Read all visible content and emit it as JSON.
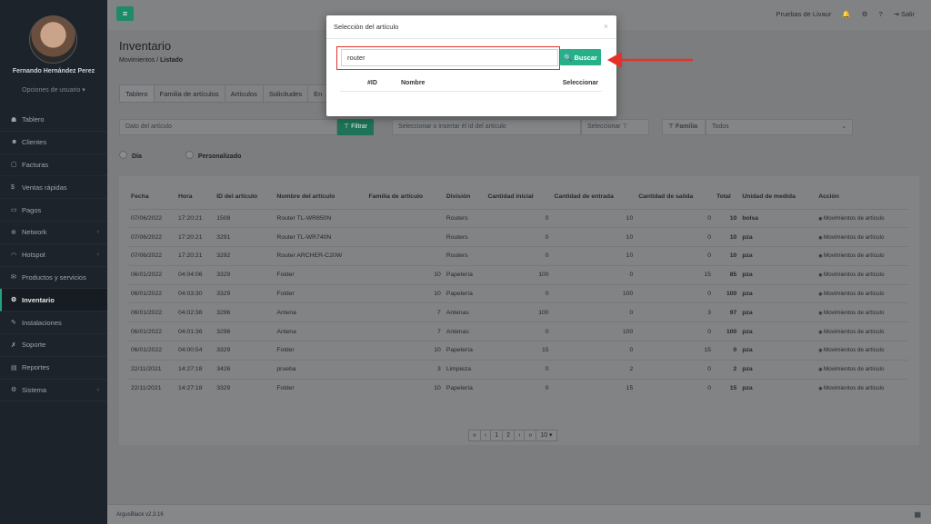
{
  "user": {
    "name": "Fernando Hernández Perez",
    "options": "Opciones de usuario ▾"
  },
  "sidebar": {
    "items": [
      {
        "icon": "dashboard-icon",
        "glyph": "☗",
        "label": "Tablero"
      },
      {
        "icon": "users-icon",
        "glyph": "☻",
        "label": "Clientes"
      },
      {
        "icon": "invoice-icon",
        "glyph": "▢",
        "label": "Facturas"
      },
      {
        "icon": "dollar-icon",
        "glyph": "$",
        "label": "Ventas rápidas"
      },
      {
        "icon": "payments-icon",
        "glyph": "▭",
        "label": "Pagos"
      },
      {
        "icon": "network-icon",
        "glyph": "✲",
        "label": "Network",
        "chev": "‹"
      },
      {
        "icon": "wifi-icon",
        "glyph": "◠",
        "label": "Hotspot",
        "chev": "‹"
      },
      {
        "icon": "products-icon",
        "glyph": "✉",
        "label": "Productos y servicios"
      },
      {
        "icon": "inventory-icon",
        "glyph": "⚙",
        "label": "Inventario",
        "active": true
      },
      {
        "icon": "install-icon",
        "glyph": "✎",
        "label": "Instalaciones"
      },
      {
        "icon": "support-icon",
        "glyph": "✗",
        "label": "Soporte"
      },
      {
        "icon": "reports-icon",
        "glyph": "▤",
        "label": "Reportes"
      },
      {
        "icon": "system-icon",
        "glyph": "⚙",
        "label": "Sistema",
        "chev": "‹"
      }
    ]
  },
  "topbar": {
    "user_label": "Pruebas de Livaur",
    "logout": "Salir"
  },
  "page": {
    "title": "Inventario",
    "breadcrumb_parent": "Movimientos",
    "breadcrumb_current": "Listado"
  },
  "tabs": [
    "Tablero",
    "Familia de artículos",
    "Artículos",
    "Solicitudes",
    "En"
  ],
  "filters": {
    "article_placeholder": "Dato del artículo",
    "filter_btn": "⊤ Filtrar",
    "select_article_placeholder": "Seleccionar o insertar él id del artículo",
    "select_btn": "Seleccionar",
    "family_label": "⊤ Familia",
    "family_value": "Todos"
  },
  "radios": [
    "Día",
    "Personalizado"
  ],
  "table": {
    "headers": [
      "Fecha",
      "Hora",
      "ID del artículo",
      "Nombre del artículo",
      "Familia de artículo",
      "División",
      "Cantidad inicial",
      "Cantidad de entrada",
      "Cantidad de salida",
      "Total",
      "Unidad de medida",
      "Acción"
    ],
    "rows": [
      [
        "07/06/2022",
        "17:20:21",
        "1508",
        "Router TL-WR850N",
        "",
        "Routers",
        "0",
        "10",
        "0",
        "10",
        "bolsa",
        "Movimientos de artículo"
      ],
      [
        "07/06/2022",
        "17:20:21",
        "3291",
        "Router TL-WR740N",
        "",
        "Routers",
        "0",
        "10",
        "0",
        "10",
        "pza",
        "Movimientos de artículo"
      ],
      [
        "07/06/2022",
        "17:20:21",
        "3292",
        "Router ARCHER-C20W",
        "",
        "Routers",
        "0",
        "10",
        "0",
        "10",
        "pza",
        "Movimientos de artículo"
      ],
      [
        "06/01/2022",
        "04:04:06",
        "3329",
        "Folder",
        "10",
        "Papelería",
        "100",
        "0",
        "15",
        "85",
        "pza",
        "Movimientos de artículo"
      ],
      [
        "06/01/2022",
        "04:03:30",
        "3329",
        "Folder",
        "10",
        "Papelería",
        "0",
        "100",
        "0",
        "100",
        "pza",
        "Movimientos de artículo"
      ],
      [
        "06/01/2022",
        "04:02:38",
        "3296",
        "Antena",
        "7",
        "Antenas",
        "100",
        "0",
        "3",
        "97",
        "pza",
        "Movimientos de artículo"
      ],
      [
        "06/01/2022",
        "04:01:36",
        "3296",
        "Antena",
        "7",
        "Antenas",
        "0",
        "100",
        "0",
        "100",
        "pza",
        "Movimientos de artículo"
      ],
      [
        "06/01/2022",
        "04:00:54",
        "3329",
        "Folder",
        "10",
        "Papelería",
        "15",
        "0",
        "15",
        "0",
        "pza",
        "Movimientos de artículo"
      ],
      [
        "22/11/2021",
        "14:27:18",
        "3426",
        "prueba",
        "3",
        "Limpieza",
        "0",
        "2",
        "0",
        "2",
        "pza",
        "Movimientos de artículo"
      ],
      [
        "22/11/2021",
        "14:27:18",
        "3329",
        "Folder",
        "10",
        "Papelería",
        "0",
        "15",
        "0",
        "15",
        "pza",
        "Movimientos de artículo"
      ]
    ]
  },
  "pager": [
    "«",
    "‹",
    "1",
    "2",
    "›",
    "»",
    "10 ▾"
  ],
  "footer": {
    "version": "ArgusBlack v2.3.16"
  },
  "modal": {
    "title": "Selección del artículo",
    "close": "×",
    "search_value": "router",
    "search_btn": "🔍 Buscar",
    "col_id": "#ID",
    "col_name": "Nombre",
    "col_select": "Seleccionar"
  },
  "colors": {
    "accent": "#26b08a",
    "sidebar": "#1c232b",
    "highlight": "#e0322b"
  }
}
